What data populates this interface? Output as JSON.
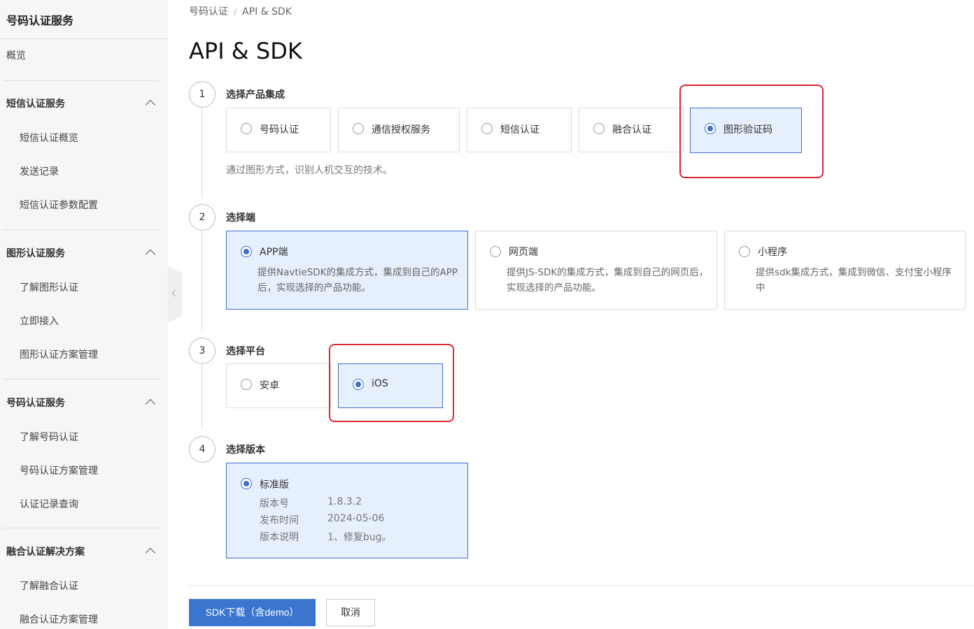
{
  "sidebar": {
    "title": "号码认证服务",
    "overview": "概览",
    "groups": [
      {
        "label": "短信认证服务",
        "items": [
          "短信认证概览",
          "发送记录",
          "短信认证参数配置"
        ]
      },
      {
        "label": "图形认证服务",
        "items": [
          "了解图形认证",
          "立即接入",
          "图形认证方案管理"
        ]
      },
      {
        "label": "号码认证服务",
        "items": [
          "了解号码认证",
          "号码认证方案管理",
          "认证记录查询"
        ]
      },
      {
        "label": "融合认证解决方案",
        "items": [
          "了解融合认证",
          "融合认证方案管理"
        ]
      }
    ]
  },
  "breadcrumb": {
    "parent": "号码认证",
    "separator": "/",
    "current": "API & SDK"
  },
  "page_title": "API & SDK",
  "steps": [
    {
      "number": "1",
      "title": "选择产品集成",
      "options": [
        "号码认证",
        "通信授权服务",
        "短信认证",
        "融合认证",
        "图形验证码"
      ],
      "selected": "图形验证码",
      "helper": "通过图形方式，识别人机交互的技术。"
    },
    {
      "number": "2",
      "title": "选择端",
      "options": [
        {
          "label": "APP端",
          "desc": "提供NavtieSDK的集成方式，集成到自己的APP后，实现选择的产品功能。"
        },
        {
          "label": "网页端",
          "desc": "提供JS-SDK的集成方式，集成到自己的网页后，实现选择的产品功能。"
        },
        {
          "label": "小程序",
          "desc": "提供sdk集成方式，集成到微信、支付宝小程序中"
        }
      ],
      "selected": "APP端"
    },
    {
      "number": "3",
      "title": "选择平台",
      "options": [
        "安卓",
        "iOS"
      ],
      "selected": "iOS"
    },
    {
      "number": "4",
      "title": "选择版本",
      "option": {
        "label": "标准版",
        "version_key": "版本号",
        "version_value": "1.8.3.2",
        "date_key": "发布时间",
        "date_value": "2024-05-06",
        "notes_key": "版本说明",
        "notes_value": "1、修复bug。"
      },
      "selected": "标准版"
    }
  ],
  "actions": {
    "download": "SDK下载（含demo）",
    "cancel": "取消"
  },
  "colors": {
    "accent": "#3b6fd1",
    "selected_bg": "#e6effc",
    "highlight": "#e0262c",
    "primary_button": "#3a76cf"
  }
}
